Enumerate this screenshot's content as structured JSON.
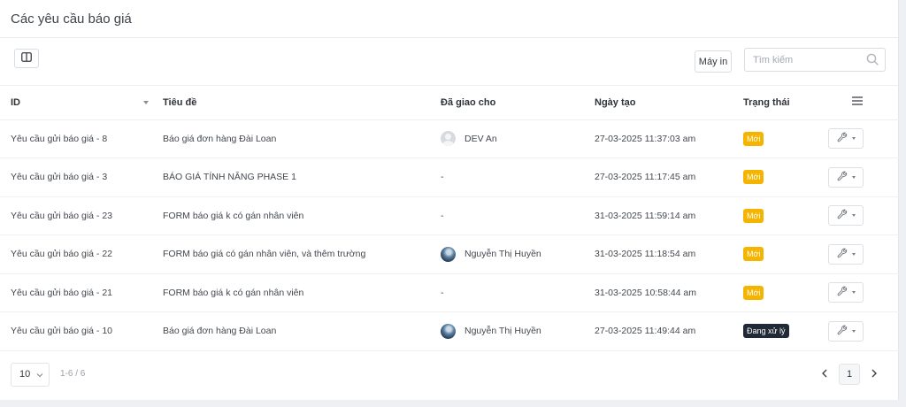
{
  "header": {
    "title": "Các yêu cầu báo giá"
  },
  "toolbar": {
    "column_toggle_icon": "columns-icon",
    "printer_label": "Máy in",
    "search_placeholder": "Tìm kiếm",
    "search_icon": "search-icon"
  },
  "table": {
    "columns": {
      "id": "ID",
      "title": "Tiêu đề",
      "assigned": "Đã giao cho",
      "created": "Ngày tạo",
      "status": "Trạng thái"
    },
    "menu_icon": "hamburger-menu-icon",
    "rows": [
      {
        "id": "Yêu cầu gửi báo giá - 8",
        "title": "Báo giá đơn hàng Đài Loan",
        "assignee": "DEV An",
        "avatar": "default",
        "created": "27-03-2025 11:37:03 am",
        "status": "Mới",
        "status_type": "new"
      },
      {
        "id": "Yêu cầu gửi báo giá - 3",
        "title": "BÁO GIÁ TÍNH NĂNG PHASE 1",
        "assignee": "-",
        "avatar": "",
        "created": "27-03-2025 11:17:45 am",
        "status": "Mới",
        "status_type": "new"
      },
      {
        "id": "Yêu cầu gửi báo giá - 23",
        "title": "FORM báo giá k có gán nhân viên",
        "assignee": "-",
        "avatar": "",
        "created": "31-03-2025 11:59:14 am",
        "status": "Mới",
        "status_type": "new"
      },
      {
        "id": "Yêu cầu gửi báo giá - 22",
        "title": "FORM báo giá có gán nhân viên, và thêm trường",
        "assignee": "Nguyễn Thị Huyền",
        "avatar": "photo",
        "created": "31-03-2025 11:18:54 am",
        "status": "Mới",
        "status_type": "new"
      },
      {
        "id": "Yêu cầu gửi báo giá - 21",
        "title": "FORM báo giá k có gán nhân viên",
        "assignee": "-",
        "avatar": "",
        "created": "31-03-2025 10:58:44 am",
        "status": "Mới",
        "status_type": "new"
      },
      {
        "id": "Yêu cầu gửi báo giá - 10",
        "title": "Báo giá đơn hàng Đài Loan",
        "assignee": "Nguyễn Thị Huyền",
        "avatar": "photo",
        "created": "27-03-2025 11:49:44 am",
        "status": "Đang xử lý",
        "status_type": "proc"
      }
    ],
    "action_icon": "wrench-icon"
  },
  "footer": {
    "page_size": "10",
    "range": "1-6 / 6",
    "current_page": "1",
    "prev_icon": "chevron-left-icon",
    "next_icon": "chevron-right-icon"
  }
}
